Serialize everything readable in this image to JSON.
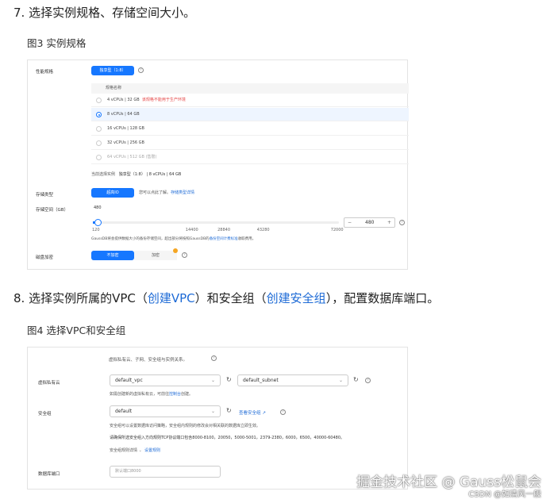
{
  "step7": {
    "title": "7. 选择实例规格、存储空间大小。",
    "caption": "图3 实例规格"
  },
  "spec": {
    "perf_label": "性能规格",
    "perf_type": "独享型（1:8）",
    "col_name": "规格名称",
    "options": [
      {
        "label": "4 vCPUs | 32 GB",
        "note": "该规格不能用于生产环境",
        "selected": false,
        "disabled": false
      },
      {
        "label": "8 vCPUs | 64 GB",
        "note": "",
        "selected": true,
        "disabled": false
      },
      {
        "label": "16 vCPUs | 128 GB",
        "note": "",
        "selected": false,
        "disabled": false
      },
      {
        "label": "32 vCPUs | 256 GB",
        "note": "",
        "selected": false,
        "disabled": false
      },
      {
        "label": "64 vCPUs | 512 GB (售罄)",
        "note": "",
        "selected": false,
        "disabled": true
      }
    ],
    "current_label": "当前选择实例",
    "current_value": "独享型（1:8） | 8 vCPUs | 64 GB",
    "storage_type_label": "存储类型",
    "storage_type": "超高IO",
    "storage_hint": "您可以点此了解。",
    "storage_link": "存储类型详情",
    "storage_size_label": "存储空间（GB）",
    "storage_value": "480",
    "slider_fraction": 0.005,
    "slider_ticks": [
      "120",
      "14400",
      "28840",
      "43280",
      "72000"
    ],
    "stepper_minus": "−",
    "stepper_plus": "+",
    "storage_note": "GaussDB将会提供数据大小的备份存储空间，超出部分将按照GaussDB的",
    "storage_note_link": "备份空间计费标准",
    "storage_note_end": "收取费用。",
    "encrypt_label": "磁盘加密",
    "encrypt_off": "不加密",
    "encrypt_on": "加密"
  },
  "step8": {
    "prefix": "8. 选择实例所属的VPC（",
    "link1": "创建VPC",
    "mid": "）和安全组（",
    "link2": "创建安全组",
    "suffix": "），配置数据库端口。",
    "caption": "图4 选择VPC和安全组"
  },
  "net": {
    "relation": "虚拟私有云、子网、安全组与实例关系。",
    "vpc_label": "虚拟私有云",
    "vpc": "default_vpc",
    "subnet": "default_subnet",
    "vpc_hint": "如需创建新的虚拟私有云，可前往",
    "vpc_hint_link": "控制台",
    "vpc_hint_end": "创建。",
    "sg_label": "安全组",
    "sg": "default",
    "sg_link": "查看安全组",
    "sg_hint": "安全组可以设置数据库访问策略，安全组内规则的修改会对相关联的数据库立即生效。",
    "sg_ports": "请确保所选安全组入方向规则TCP协议端口包含8000-8100，20050，5000-5001，2379-2380，6000，6500，40000-60480。",
    "sg_rules": "安全组规则详情",
    "sg_set": "设置规则",
    "port_label": "数据库端口",
    "port_placeholder": "默认端口8000"
  },
  "watermark": {
    "juejin": "掘金技术社区 @ Gauss松鼠会",
    "csdn": "CSDN @如清风一般"
  }
}
